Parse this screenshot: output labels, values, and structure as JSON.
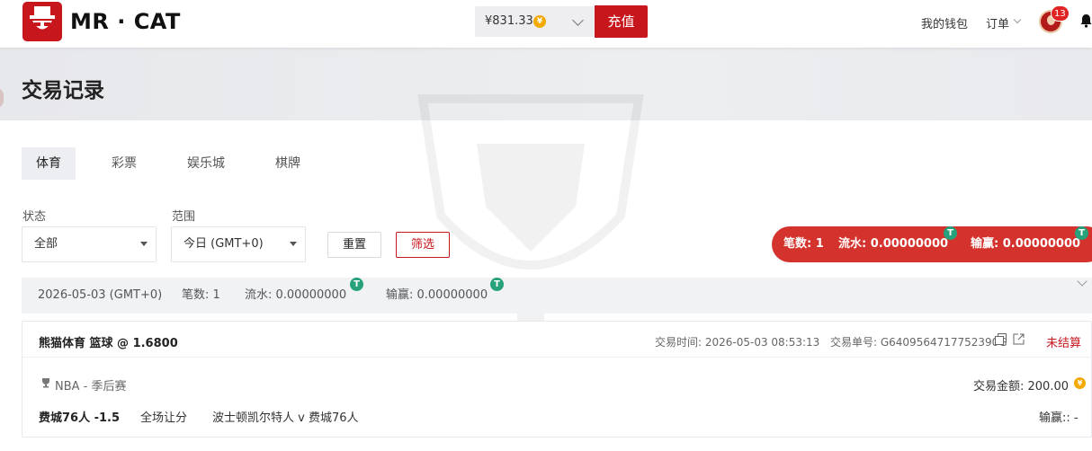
{
  "header": {
    "brand": "MR · CAT",
    "balance": "¥831.33",
    "balance_coin": "¥",
    "recharge_label": "充值",
    "wallet_label": "我的钱包",
    "orders_label": "订单",
    "notification_count": "13"
  },
  "page": {
    "title": "交易记录"
  },
  "tabs": [
    {
      "label": "体育",
      "active": true
    },
    {
      "label": "彩票",
      "active": false
    },
    {
      "label": "娱乐城",
      "active": false
    },
    {
      "label": "棋牌",
      "active": false
    }
  ],
  "filters": {
    "status_label": "状态",
    "status_value": "全部",
    "range_label": "范围",
    "range_value": "今日 (GMT+0)",
    "reset_label": "重置",
    "filter_label": "筛选"
  },
  "summary": {
    "count_text": "笔数: 1",
    "turnover_text": "流水: 0.00000000",
    "winloss_text": "输赢: 0.00000000",
    "coin_symbol": "T"
  },
  "date_group": {
    "date": "2026-05-03 (GMT+0)",
    "count_text": "笔数: 1",
    "turnover_text": "流水: 0.00000000",
    "winloss_text": "输赢: 0.00000000"
  },
  "record": {
    "title": "熊猫体育  篮球 @ 1.6800",
    "time_label": "交易时间: 2026-05-03 08:53:13",
    "order_label": "交易单号: G6409564717752390G",
    "status": "未结算",
    "league": "NBA - 季后赛",
    "amount_label": "交易金额: 200.00",
    "pick": "费城76人 -1.5",
    "market": "全场让分",
    "match": "波士顿凯尔特人 v 费城76人",
    "winloss_label": "输赢:: -"
  },
  "colors": {
    "brand_red": "#c8161d",
    "tether_green": "#26a17b",
    "coin_gold": "#f2a900"
  }
}
